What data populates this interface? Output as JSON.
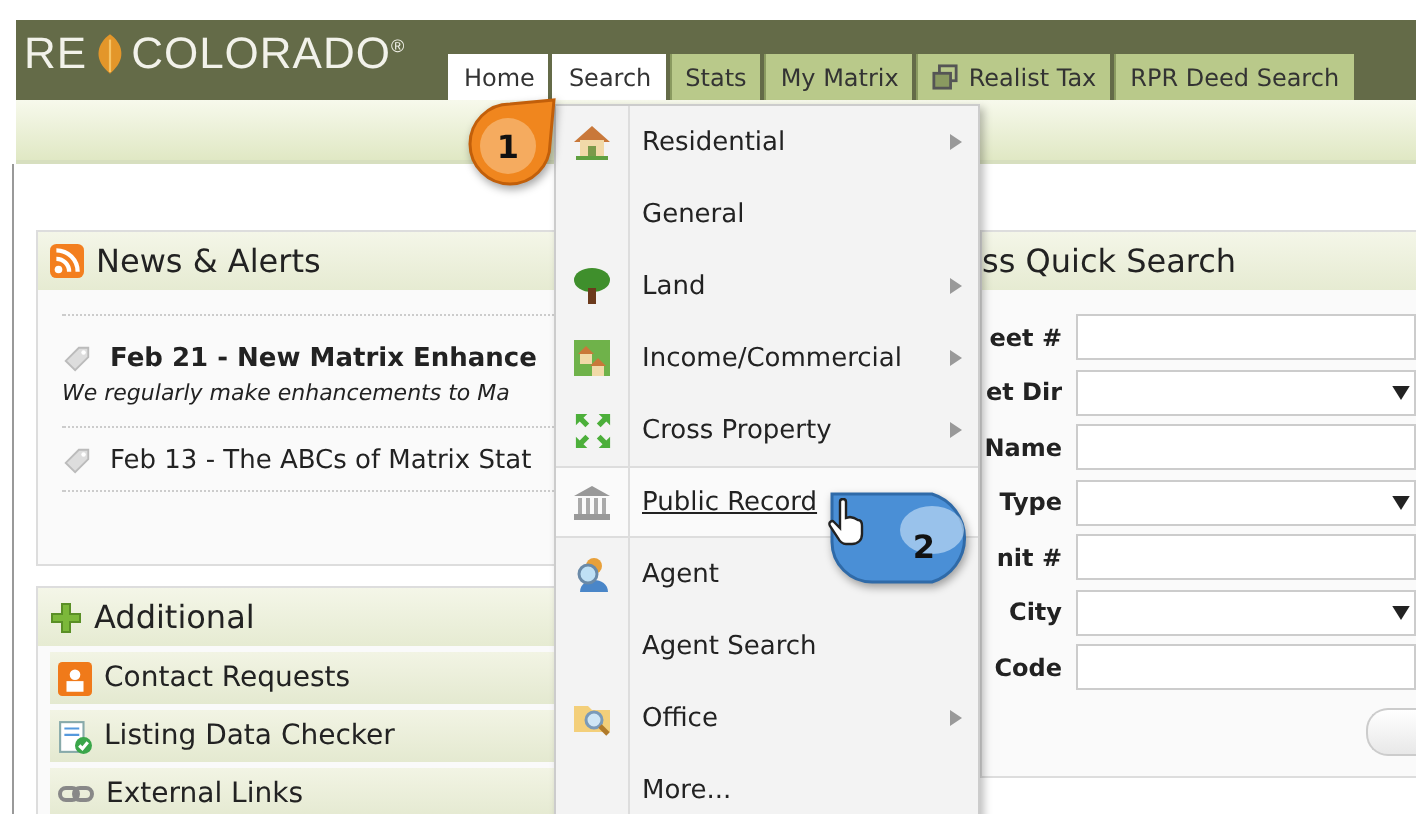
{
  "logo": {
    "prefix": "RE",
    "name": "COLORADO",
    "mark": "®"
  },
  "tabs": [
    {
      "label": "Home",
      "kind": "text",
      "active": true
    },
    {
      "label": "Search",
      "kind": "text",
      "active": true
    },
    {
      "label": "Stats",
      "kind": "text",
      "active": false
    },
    {
      "label": "My Matrix",
      "kind": "text",
      "active": false
    },
    {
      "label": "Realist Tax",
      "kind": "window",
      "active": false
    },
    {
      "label": "RPR Deed Search",
      "kind": "text",
      "active": false
    }
  ],
  "search_menu": [
    {
      "label": "Residential",
      "kind": "house",
      "submenu": true,
      "hovered": false
    },
    {
      "label": "General",
      "kind": "plain",
      "submenu": false,
      "hovered": false
    },
    {
      "label": "Land",
      "kind": "tree",
      "submenu": true,
      "hovered": false
    },
    {
      "label": "Income/Commercial",
      "kind": "buildings",
      "submenu": true,
      "hovered": false
    },
    {
      "label": "Cross Property",
      "kind": "arrows",
      "submenu": true,
      "hovered": false
    },
    {
      "label": "Public Record",
      "kind": "bank",
      "submenu": false,
      "hovered": true
    },
    {
      "label": "Agent",
      "kind": "agent",
      "submenu": false,
      "hovered": false
    },
    {
      "label": "Agent Search",
      "kind": "plain",
      "submenu": false,
      "hovered": false
    },
    {
      "label": "Office",
      "kind": "folder",
      "submenu": true,
      "hovered": false
    },
    {
      "label": "More...",
      "kind": "plain",
      "submenu": false,
      "hovered": false
    }
  ],
  "news": {
    "title": "News & Alerts",
    "items": [
      {
        "title": "Feb 21 - New Matrix Enhance",
        "bold": true,
        "summary": "We regularly make enhancements to Ma"
      },
      {
        "title": "Feb 13 - The ABCs of Matrix Stat",
        "bold": false
      }
    ]
  },
  "additional": {
    "title": "Additional",
    "items": [
      {
        "label": "Contact Requests",
        "kind": "contact"
      },
      {
        "label": "Listing Data Checker",
        "kind": "checker"
      },
      {
        "label": "External Links",
        "kind": "link"
      }
    ]
  },
  "quick_search": {
    "title": "ss Quick Search",
    "fields": [
      {
        "label": "eet #",
        "kind": "text"
      },
      {
        "label": "et Dir",
        "kind": "select"
      },
      {
        "label": "Name",
        "kind": "text"
      },
      {
        "label": "Type",
        "kind": "select"
      },
      {
        "label": "nit #",
        "kind": "text"
      },
      {
        "label": "City",
        "kind": "select"
      },
      {
        "label": "Code",
        "kind": "text"
      }
    ]
  },
  "callouts": [
    {
      "number": "1",
      "color": "#f0861e"
    },
    {
      "number": "2",
      "color": "#4a8fd6"
    }
  ]
}
